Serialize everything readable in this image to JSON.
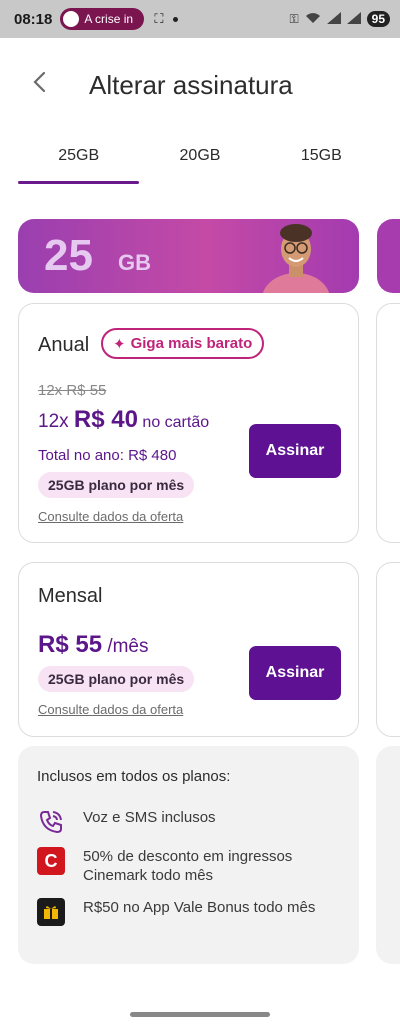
{
  "status": {
    "time": "08:18",
    "notification": "A crise in",
    "battery": "95"
  },
  "header": {
    "back_icon": "chevron-left-icon",
    "title": "Alterar assinatura"
  },
  "tabs": [
    {
      "label": "25GB",
      "active": true
    },
    {
      "label": "20GB",
      "active": false
    },
    {
      "label": "15GB",
      "active": false
    }
  ],
  "banner": {
    "gb_number": "25",
    "gb_unit": "GB"
  },
  "annual_plan": {
    "title": "Anual",
    "badge": "Giga mais barato",
    "old_price": "12x R$ 55",
    "price_prefix": "12x ",
    "price_value": "R$ 40",
    "price_suffix": " no cartão",
    "total_year": "Total no ano: R$ 480",
    "data_label": "25GB plano por mês",
    "offer_link": "Consulte dados da oferta",
    "button": "Assinar"
  },
  "monthly_plan": {
    "title": "Mensal",
    "price_value": "R$ 55",
    "price_suffix": " /mês",
    "data_label": "25GB plano por mês",
    "offer_link": "Consulte dados da oferta",
    "button": "Assinar"
  },
  "included": {
    "title": "Inclusos em todos os planos:",
    "benefits": [
      {
        "icon": "phone-icon",
        "text": "Voz e SMS inclusos"
      },
      {
        "icon": "cinemark-icon",
        "text": "50% de desconto em ingressos Cinemark todo mês"
      },
      {
        "icon": "gift-icon",
        "text": "R$50 no App Vale Bonus todo mês"
      }
    ]
  },
  "colors": {
    "primary": "#5e1293",
    "accent": "#c0237a",
    "tab_indicator": "#6a1a8c"
  }
}
